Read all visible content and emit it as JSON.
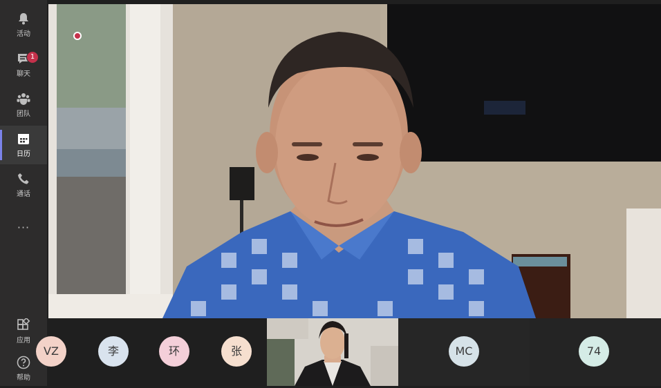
{
  "rail": {
    "items": [
      {
        "label": "活动",
        "icon": "bell-icon"
      },
      {
        "label": "聊天",
        "icon": "chat-icon",
        "badge": "1"
      },
      {
        "label": "团队",
        "icon": "teams-icon"
      },
      {
        "label": "日历",
        "icon": "calendar-icon",
        "active": true
      },
      {
        "label": "通话",
        "icon": "phone-icon"
      },
      {
        "label": "···",
        "icon": "more-icon"
      }
    ],
    "bottom_items": [
      {
        "label": "应用",
        "icon": "apps-icon"
      },
      {
        "label": "帮助",
        "icon": "help-icon"
      }
    ]
  },
  "participants": [
    {
      "initials": "VZ",
      "color": "#f3d2c8"
    },
    {
      "initials": "李",
      "color": "#d9e3ee"
    },
    {
      "initials": "环",
      "color": "#f4cfd9"
    },
    {
      "initials": "张",
      "color": "#f6dfcf"
    },
    {
      "initials": "MC",
      "color": "#d6e2e8"
    },
    {
      "initials": "74",
      "color": "#d5ece6"
    }
  ],
  "colors": {
    "rail_bg": "#2d2c2c",
    "accent": "#7b83eb",
    "badge": "#c4314b",
    "stage_bg": "#1f1f1f"
  }
}
